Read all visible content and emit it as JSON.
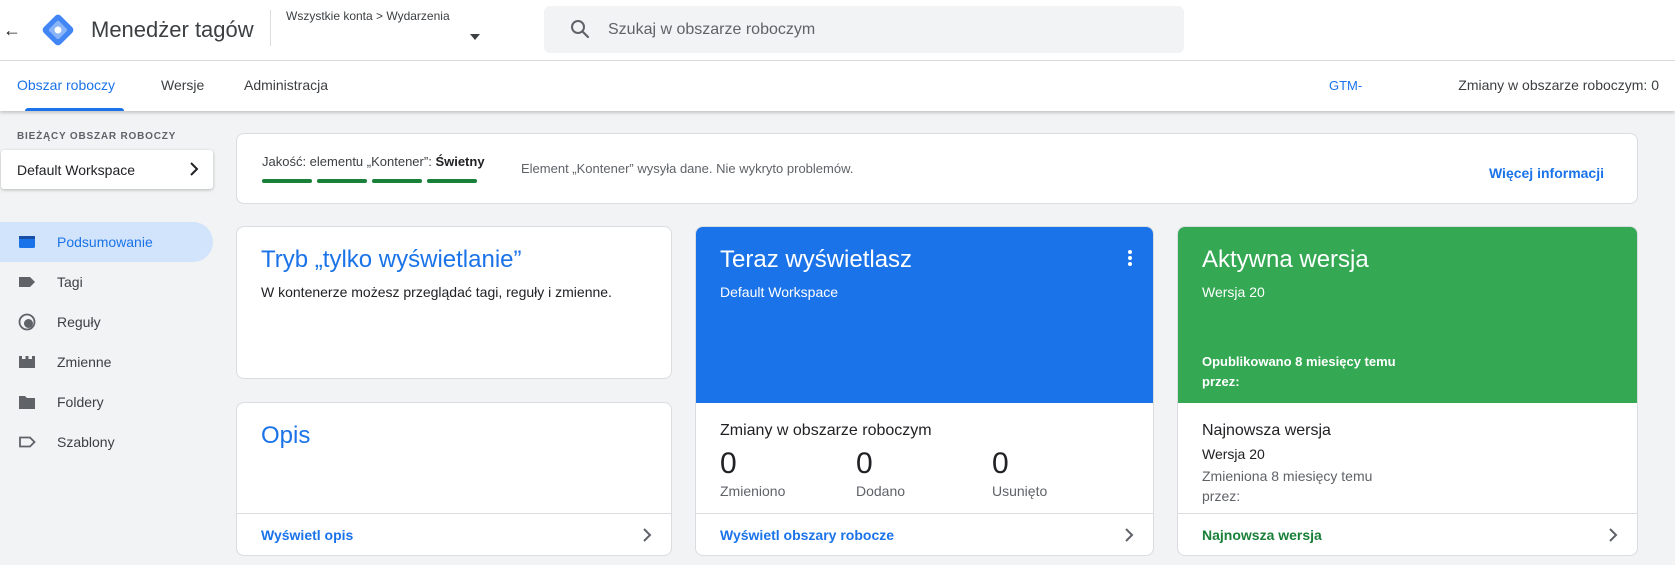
{
  "header": {
    "app_title": "Menedżer tagów",
    "breadcrumb": "Wszystkie konta > Wydarzenia",
    "search_placeholder": "Szukaj w obszarze roboczym"
  },
  "tabs": {
    "workspace": "Obszar roboczy",
    "versions": "Wersje",
    "admin": "Administracja",
    "gtm_id": "GTM-",
    "changes": "Zmiany w obszarze roboczym: 0"
  },
  "sidebar": {
    "workspace_label": "BIEŻĄCY OBSZAR ROBOCZY",
    "workspace_name": "Default Workspace",
    "items": [
      {
        "label": "Podsumowanie",
        "icon": "summary-icon",
        "active": true
      },
      {
        "label": "Tagi",
        "icon": "tag-icon"
      },
      {
        "label": "Reguły",
        "icon": "trigger-icon"
      },
      {
        "label": "Zmienne",
        "icon": "variable-icon"
      },
      {
        "label": "Foldery",
        "icon": "folder-icon"
      },
      {
        "label": "Szablony",
        "icon": "template-icon"
      }
    ]
  },
  "quality": {
    "label": "Jakość: elementu „Kontener”:",
    "value": "Świetny",
    "message": "Element „Kontener” wysyła dane. Nie wykryto problemów.",
    "more": "Więcej informacji",
    "bars_filled": 4,
    "bars_total": 4,
    "color": "#188038"
  },
  "view_mode": {
    "title": "Tryb „tylko wyświetlanie”",
    "text": "W kontenerze możesz przeglądać tagi, reguły i zmienne."
  },
  "description": {
    "title": "Opis",
    "link": "Wyświetl opis"
  },
  "current": {
    "title": "Teraz wyświetlasz",
    "subtitle": "Default Workspace",
    "changes_title": "Zmiany w obszarze roboczym",
    "stats": [
      {
        "value": "0",
        "label": "Zmieniono"
      },
      {
        "value": "0",
        "label": "Dodano"
      },
      {
        "value": "0",
        "label": "Usunięto"
      }
    ],
    "link": "Wyświetl obszary robocze",
    "color": "#1a73e8"
  },
  "live": {
    "title": "Aktywna wersja",
    "subtitle": "Wersja 20",
    "published": "Opublikowano 8 miesięcy temu przez:",
    "latest_title": "Najnowsza wersja",
    "latest_version": "Wersja 20",
    "latest_modified": "Zmieniona 8 miesięcy temu przez:",
    "link": "Najnowsza wersja",
    "color": "#34a853"
  }
}
